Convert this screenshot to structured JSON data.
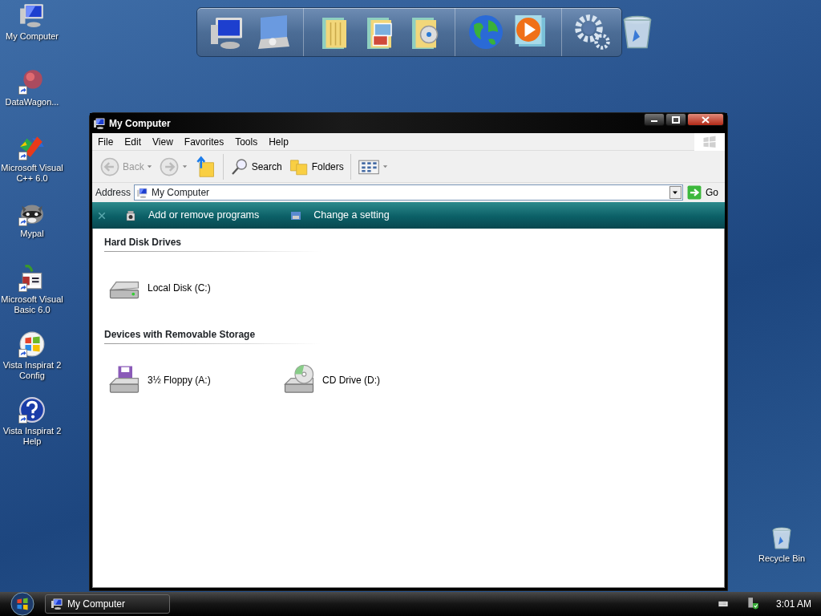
{
  "desktop_icons": [
    {
      "label": "My Computer",
      "kind": "computer",
      "shortcut": false
    },
    {
      "label": "DataWagon...",
      "kind": "blob",
      "shortcut": true
    },
    {
      "label": "Microsoft Visual C++ 6.0",
      "kind": "vcpp",
      "shortcut": true
    },
    {
      "label": "Mypal",
      "kind": "raccoon",
      "shortcut": true
    },
    {
      "label": "Microsoft Visual Basic 6.0",
      "kind": "vb",
      "shortcut": true
    },
    {
      "label": "Vista Inspirat 2 Config",
      "kind": "windows",
      "shortcut": true
    },
    {
      "label": "Vista Inspirat 2 Help",
      "kind": "help",
      "shortcut": true
    }
  ],
  "recycle_bin": {
    "label": "Recycle Bin"
  },
  "window": {
    "title": "My Computer",
    "menu": [
      "File",
      "Edit",
      "View",
      "Favorites",
      "Tools",
      "Help"
    ],
    "toolbar": [
      {
        "kind": "back",
        "label": "Back",
        "disabled": true
      },
      {
        "kind": "forward",
        "disabled": true
      },
      {
        "kind": "up",
        "disabled": false
      },
      {
        "kind": "search",
        "label": "Search",
        "disabled": false
      },
      {
        "kind": "folders",
        "label": "Folders",
        "disabled": false
      },
      {
        "kind": "views",
        "disabled": false
      }
    ],
    "address": {
      "label": "Address",
      "value": "My Computer",
      "go": "Go"
    },
    "tasks": [
      {
        "label": "Add or remove programs",
        "kind": "programs"
      },
      {
        "label": "Change a setting",
        "kind": "setting"
      }
    ],
    "sections": [
      {
        "title": "Hard Disk Drives",
        "items": [
          {
            "label": "Local Disk (C:)",
            "kind": "hdd"
          }
        ]
      },
      {
        "title": "Devices with Removable Storage",
        "items": [
          {
            "label": "3½ Floppy (A:)",
            "kind": "floppy"
          },
          {
            "label": "CD Drive (D:)",
            "kind": "cd"
          }
        ]
      }
    ]
  },
  "taskbar": {
    "tasks": [
      {
        "label": "My Computer"
      }
    ],
    "clock": "3:01 AM"
  }
}
